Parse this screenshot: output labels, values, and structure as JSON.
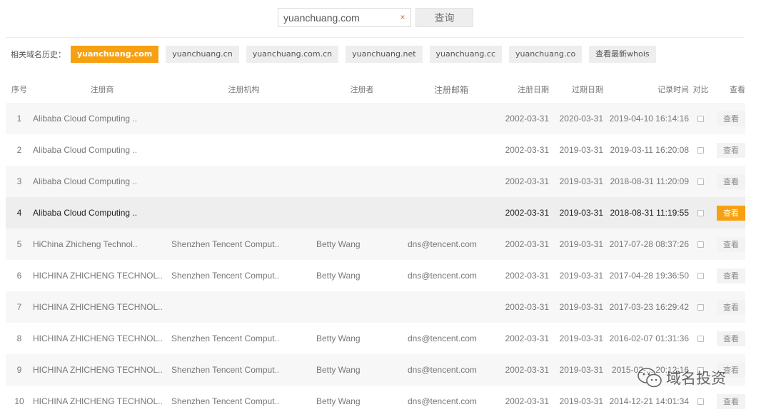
{
  "search": {
    "value": "yuanchuang.com",
    "clear_symbol": "×",
    "button_label": "查询"
  },
  "history": {
    "label": "相关域名历史：",
    "tags": [
      {
        "label": "yuanchuang.com",
        "active": true
      },
      {
        "label": "yuanchuang.cn",
        "active": false
      },
      {
        "label": "yuanchuang.com.cn",
        "active": false
      },
      {
        "label": "yuanchuang.net",
        "active": false
      },
      {
        "label": "yuanchuang.cc",
        "active": false
      },
      {
        "label": "yuanchuang.co",
        "active": false
      },
      {
        "label": "查看最新whois",
        "active": false
      }
    ]
  },
  "table": {
    "headers": {
      "index": "序号",
      "registrar": "注册商",
      "organization": "注册机构",
      "registrant": "注册者",
      "email": "注册邮箱",
      "reg_date": "注册日期",
      "exp_date": "过期日期",
      "record_time": "记录时间",
      "compare": "对比",
      "view": "查看"
    },
    "rows": [
      {
        "index": "1",
        "registrar": "Alibaba Cloud Computing ..",
        "organization": "",
        "registrant": "",
        "email": "",
        "reg_date": "2002-03-31",
        "exp_date": "2020-03-31",
        "record_time": "2019-04-10 16:14:16",
        "view": "查看"
      },
      {
        "index": "2",
        "registrar": "Alibaba Cloud Computing ..",
        "organization": "",
        "registrant": "",
        "email": "",
        "reg_date": "2002-03-31",
        "exp_date": "2019-03-31",
        "record_time": "2019-03-11 16:20:08",
        "view": "查看"
      },
      {
        "index": "3",
        "registrar": "Alibaba Cloud Computing ..",
        "organization": "",
        "registrant": "",
        "email": "",
        "reg_date": "2002-03-31",
        "exp_date": "2019-03-31",
        "record_time": "2018-08-31 11:20:09",
        "view": "查看"
      },
      {
        "index": "4",
        "registrar": "Alibaba Cloud Computing ..",
        "organization": "",
        "registrant": "",
        "email": "",
        "reg_date": "2002-03-31",
        "exp_date": "2019-03-31",
        "record_time": "2018-08-31 11:19:55",
        "view": "查看"
      },
      {
        "index": "5",
        "registrar": "HiChina Zhicheng Technol..",
        "organization": "Shenzhen Tencent Comput..",
        "registrant": "Betty Wang",
        "email": "dns@tencent.com",
        "reg_date": "2002-03-31",
        "exp_date": "2019-03-31",
        "record_time": "2017-07-28 08:37:26",
        "view": "查看"
      },
      {
        "index": "6",
        "registrar": "HICHINA ZHICHENG TECHNOL..",
        "organization": "Shenzhen Tencent Comput..",
        "registrant": "Betty Wang",
        "email": "dns@tencent.com",
        "reg_date": "2002-03-31",
        "exp_date": "2019-03-31",
        "record_time": "2017-04-28 19:36:50",
        "view": "查看"
      },
      {
        "index": "7",
        "registrar": "HICHINA ZHICHENG TECHNOL..",
        "organization": "",
        "registrant": "",
        "email": "",
        "reg_date": "2002-03-31",
        "exp_date": "2019-03-31",
        "record_time": "2017-03-23 16:29:42",
        "view": "查看"
      },
      {
        "index": "8",
        "registrar": "HICHINA ZHICHENG TECHNOL..",
        "organization": "Shenzhen Tencent Comput..",
        "registrant": "Betty Wang",
        "email": "dns@tencent.com",
        "reg_date": "2002-03-31",
        "exp_date": "2019-03-31",
        "record_time": "2016-02-07 01:31:36",
        "view": "查看"
      },
      {
        "index": "9",
        "registrar": "HICHINA ZHICHENG TECHNOL..",
        "organization": "Shenzhen Tencent Comput..",
        "registrant": "Betty Wang",
        "email": "dns@tencent.com",
        "reg_date": "2002-03-31",
        "exp_date": "2019-03-31",
        "record_time": "2015-02-... 20:12:16",
        "view": "查看"
      },
      {
        "index": "10",
        "registrar": "HICHINA ZHICHENG TECHNOL..",
        "organization": "Shenzhen Tencent Comput..",
        "registrant": "Betty Wang",
        "email": "dns@tencent.com",
        "reg_date": "2002-03-31",
        "exp_date": "2019-03-31",
        "record_time": "2014-12-21 14:01:34",
        "view": "查看"
      }
    ],
    "highlighted_row": 4
  },
  "watermark": {
    "text": "域名投资",
    "icon": "wechat-icon"
  },
  "colors": {
    "accent": "#f7a012",
    "clear": "#f05a3c"
  }
}
